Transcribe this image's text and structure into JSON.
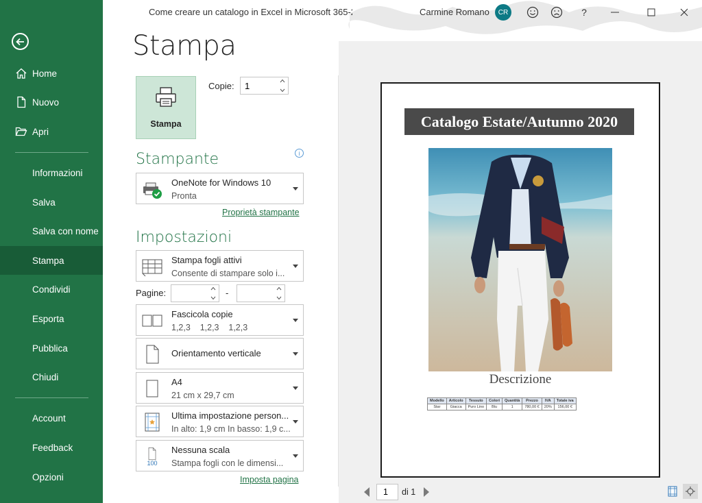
{
  "titlebar": {
    "doc_title": "Come creare un catalogo in Excel in Microsoft 365-2",
    "user_name": "Carmine Romano",
    "avatar_initials": "CR",
    "help_label": "?"
  },
  "sidebar": {
    "items": [
      {
        "label": "Home",
        "icon": "home-icon"
      },
      {
        "label": "Nuovo",
        "icon": "new-doc-icon"
      },
      {
        "label": "Apri",
        "icon": "folder-open-icon"
      },
      {
        "label": "Informazioni"
      },
      {
        "label": "Salva"
      },
      {
        "label": "Salva con nome"
      },
      {
        "label": "Stampa",
        "active": true
      },
      {
        "label": "Condividi"
      },
      {
        "label": "Esporta"
      },
      {
        "label": "Pubblica"
      },
      {
        "label": "Chiudi"
      },
      {
        "label": "Account"
      },
      {
        "label": "Feedback"
      },
      {
        "label": "Opzioni"
      }
    ],
    "colors": {
      "bg": "#217346",
      "active": "#185c37"
    }
  },
  "print": {
    "page_title": "Stampa",
    "print_button": "Stampa",
    "copies_label": "Copie:",
    "copies_value": "1",
    "printer_section": "Stampante",
    "printer_name": "OneNote for Windows 10",
    "printer_status": "Pronta",
    "printer_props_link": "Proprietà stampante",
    "info_icon": "i",
    "settings_section": "Impostazioni",
    "settings": [
      {
        "l1": "Stampa fogli attivi",
        "l2": "Consente di stampare solo i..."
      },
      {
        "l1": "Fascicola copie",
        "l2": "1,2,3    1,2,3    1,2,3"
      },
      {
        "l1": "Orientamento verticale",
        "l2": ""
      },
      {
        "l1": "A4",
        "l2": "21 cm x 29,7 cm"
      },
      {
        "l1": "Ultima impostazione person...",
        "l2": "In alto: 1,9 cm In basso: 1,9 c..."
      },
      {
        "l1": "Nessuna scala",
        "l2": "Stampa fogli con le dimensi..."
      }
    ],
    "pages_label": "Pagine:",
    "pages_from": "",
    "pages_to": "",
    "pages_dash": "-",
    "page_setup_link": "Imposta pagina",
    "scale_icon_text": "100"
  },
  "preview": {
    "catalog_title": "Catalogo Estate/Autunno 2020",
    "description": "Descrizione",
    "table": {
      "headers": [
        "Modello",
        "Articolo",
        "Tessuto",
        "Colori",
        "Quantità",
        "Prezzo",
        "IVA",
        "Totale iva"
      ],
      "rows": [
        [
          "Star",
          "Giacca",
          "Puro Lino",
          "Blu",
          "1",
          "780,00 €",
          "20%",
          "156,00 €"
        ]
      ]
    },
    "page_current": "1",
    "page_of": "di 1"
  },
  "colors": {
    "accent": "#217346",
    "print_btn_bg": "#cde6d7"
  }
}
